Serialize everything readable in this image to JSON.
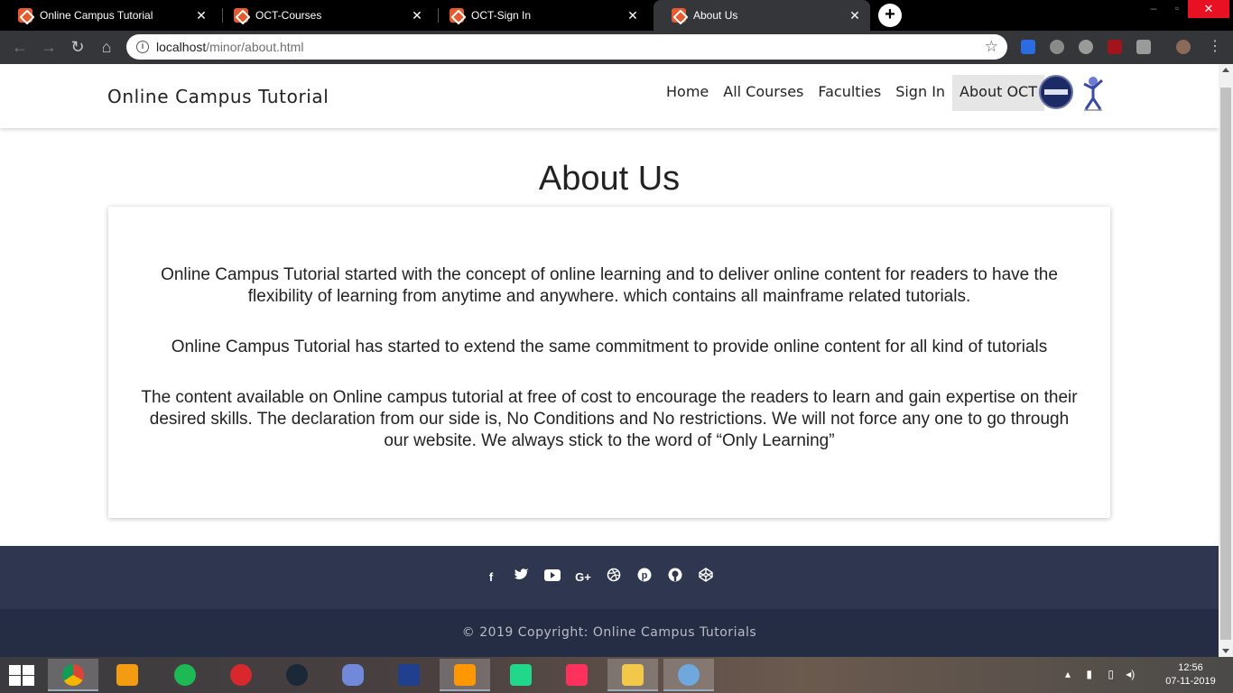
{
  "browser": {
    "tabs": [
      {
        "title": "Online Campus Tutorial",
        "active": false
      },
      {
        "title": "OCT-Courses",
        "active": false
      },
      {
        "title": "OCT-Sign In",
        "active": false
      },
      {
        "title": "About Us",
        "active": true
      }
    ],
    "url_host": "localhost",
    "url_path": "/minor/about.html"
  },
  "site": {
    "brand": "Online Campus Tutorial",
    "nav": [
      "Home",
      "All Courses",
      "Faculties",
      "Sign In",
      "About OCT"
    ],
    "active_nav": "About OCT",
    "heading": "About Us",
    "paragraphs": [
      "Online Campus Tutorial started with the concept of online learning and to deliver online content for readers to have the flexibility of learning from anytime and anywhere. which contains all mainframe related tutorials.",
      "Online Campus Tutorial has started to extend the same commitment to provide online content for all kind of tutorials",
      "The content available on Online campus tutorial at free of cost to encourage the readers to learn and gain expertise on their desired skills. The declaration from our side is, No Conditions and No restrictions. We will not force any one to go through our website. We always stick to the word of “Only Learning”"
    ],
    "social_icons": [
      "facebook-icon",
      "twitter-icon",
      "youtube-icon",
      "google-plus-icon",
      "dribbble-icon",
      "pinterest-icon",
      "github-icon",
      "codepen-icon"
    ],
    "copyright": "© 2019 Copyright: Online Campus Tutorials"
  },
  "taskbar": {
    "time": "12:56",
    "date": "07-11-2019"
  },
  "colors": {
    "footer_top": "#2e3650",
    "footer_bottom": "#252d44",
    "tab_favicon": "#e65a2e"
  }
}
